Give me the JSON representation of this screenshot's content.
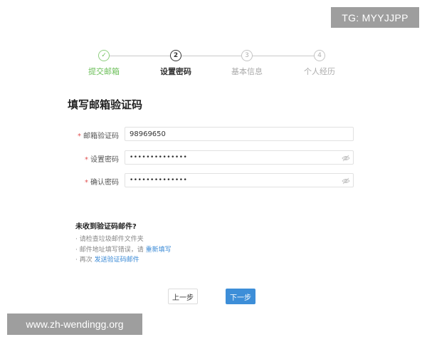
{
  "watermarks": {
    "tg": "TG: MYYJJPP",
    "site": "www.zh-wendingg.org"
  },
  "steps": [
    {
      "index": "✓",
      "label": "提交邮箱",
      "state": "done"
    },
    {
      "index": "2",
      "label": "设置密码",
      "state": "active"
    },
    {
      "index": "3",
      "label": "基本信息",
      "state": "todo"
    },
    {
      "index": "4",
      "label": "个人经历",
      "state": "todo"
    }
  ],
  "page_title": "填写邮箱验证码",
  "form": {
    "verify_code": {
      "label": "邮箱验证码",
      "value": "98969650"
    },
    "password": {
      "label": "设置密码",
      "value": "••••••••••••••"
    },
    "confirm": {
      "label": "确认密码",
      "value": "••••••••••••••"
    },
    "required_mark": "*"
  },
  "help": {
    "title": "未收到验证码邮件?",
    "line1": "· 请检查垃圾邮件文件夹",
    "line2_prefix": "· 邮件地址填写错误，请 ",
    "line2_link": "重新填写",
    "line3_prefix": "· 再次 ",
    "line3_link": "发送验证码邮件"
  },
  "buttons": {
    "prev": "上一步",
    "next": "下一步"
  },
  "colors": {
    "accent": "#3d8ed8",
    "done": "#6cbf59"
  },
  "icons": [
    "check-icon",
    "eye-off-icon"
  ]
}
